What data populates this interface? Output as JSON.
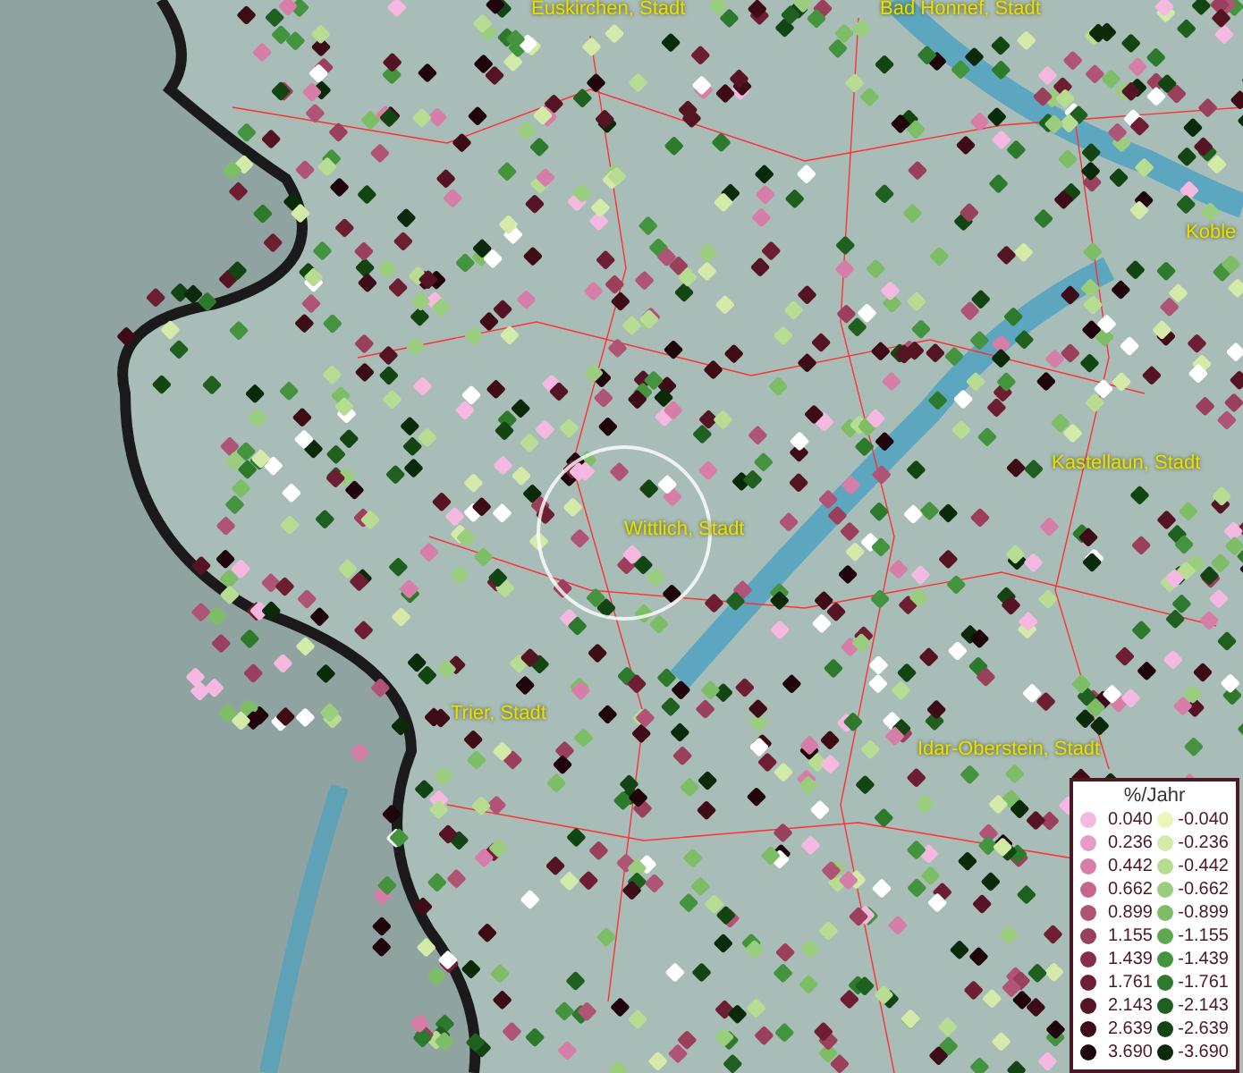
{
  "map_labels": [
    {
      "text": "Euskirchen, Stadt"
    },
    {
      "text": "Bad Honnef, Stadt"
    },
    {
      "text": "Koble"
    },
    {
      "text": "Kastellaun, Stadt"
    },
    {
      "text": "Wittlich, Stadt"
    },
    {
      "text": "Trier, Stadt"
    },
    {
      "text": "Idar-Oberstein, Stadt"
    }
  ],
  "legend": {
    "title": "%/Jahr",
    "positive": [
      {
        "label": "0.040",
        "color": "#f5b8e0"
      },
      {
        "label": "0.236",
        "color": "#e89cc4"
      },
      {
        "label": "0.442",
        "color": "#d67ea8"
      },
      {
        "label": "0.662",
        "color": "#c4678e"
      },
      {
        "label": "0.899",
        "color": "#b05475"
      },
      {
        "label": "1.155",
        "color": "#9a3f5c"
      },
      {
        "label": "1.439",
        "color": "#862e48"
      },
      {
        "label": "1.761",
        "color": "#6e1e33"
      },
      {
        "label": "2.143",
        "color": "#551424"
      },
      {
        "label": "2.639",
        "color": "#3d0c17"
      },
      {
        "label": "3.690",
        "color": "#1f050b"
      }
    ],
    "negative": [
      {
        "label": "-0.040",
        "color": "#eef5b8"
      },
      {
        "label": "-0.236",
        "color": "#d4eaa8"
      },
      {
        "label": "-0.442",
        "color": "#b8dc92"
      },
      {
        "label": "-0.662",
        "color": "#9acd7e"
      },
      {
        "label": "-0.899",
        "color": "#7cbd66"
      },
      {
        "label": "-1.155",
        "color": "#5ea850"
      },
      {
        "label": "-1.439",
        "color": "#44933e"
      },
      {
        "label": "-1.761",
        "color": "#2e7a2c"
      },
      {
        "label": "-2.143",
        "color": "#1f5f1f"
      },
      {
        "label": "-2.639",
        "color": "#134513"
      },
      {
        "label": "-3.690",
        "color": "#0a2a0a"
      }
    ]
  }
}
